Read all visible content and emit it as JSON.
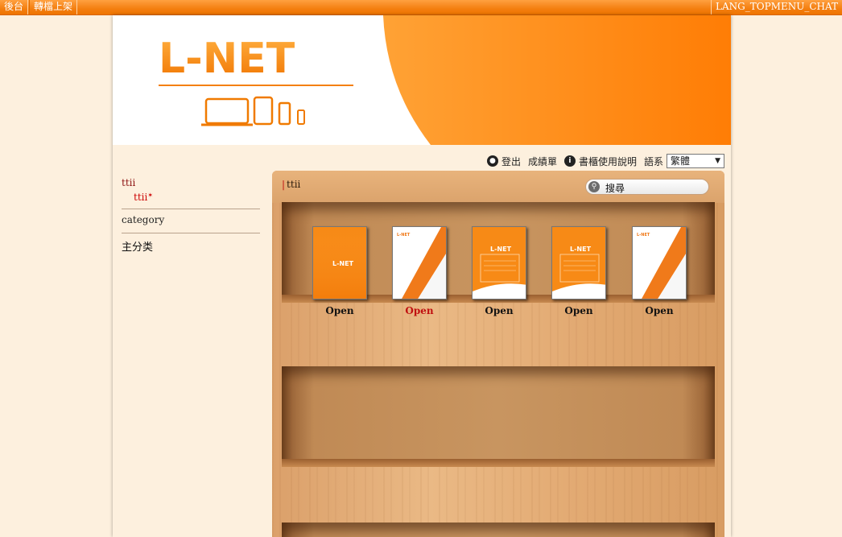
{
  "topbar": {
    "backend": "後台",
    "upload": "轉檔上架",
    "chat": "LANG_TOPMENU_CHAT"
  },
  "banner": {
    "logo_text": "L-NET",
    "colors": {
      "accent": "#ff7f00",
      "accent_light": "#ffa030"
    }
  },
  "toolbar": {
    "logout": "登出",
    "report": "成績單",
    "help": "書櫃使用說明",
    "language_label": "語系",
    "language_value": "繁體"
  },
  "sidebar": {
    "title": "ttii",
    "sub_item": "ttii",
    "category": "category",
    "main_category": "主分类"
  },
  "shelf": {
    "title": "ttii",
    "search_placeholder": "搜尋",
    "books": [
      {
        "cover_text": "L-NET",
        "style": "solid-orange",
        "label": "Open",
        "active": false
      },
      {
        "cover_text": "L-NET",
        "style": "white-stripe",
        "label": "Open",
        "active": true
      },
      {
        "cover_text": "L-NET",
        "style": "orange-document",
        "label": "Open",
        "active": false
      },
      {
        "cover_text": "L-NET",
        "style": "orange-document",
        "label": "Open",
        "active": false
      },
      {
        "cover_text": "L-NET",
        "style": "white-stripe",
        "label": "Open",
        "active": false
      }
    ]
  }
}
